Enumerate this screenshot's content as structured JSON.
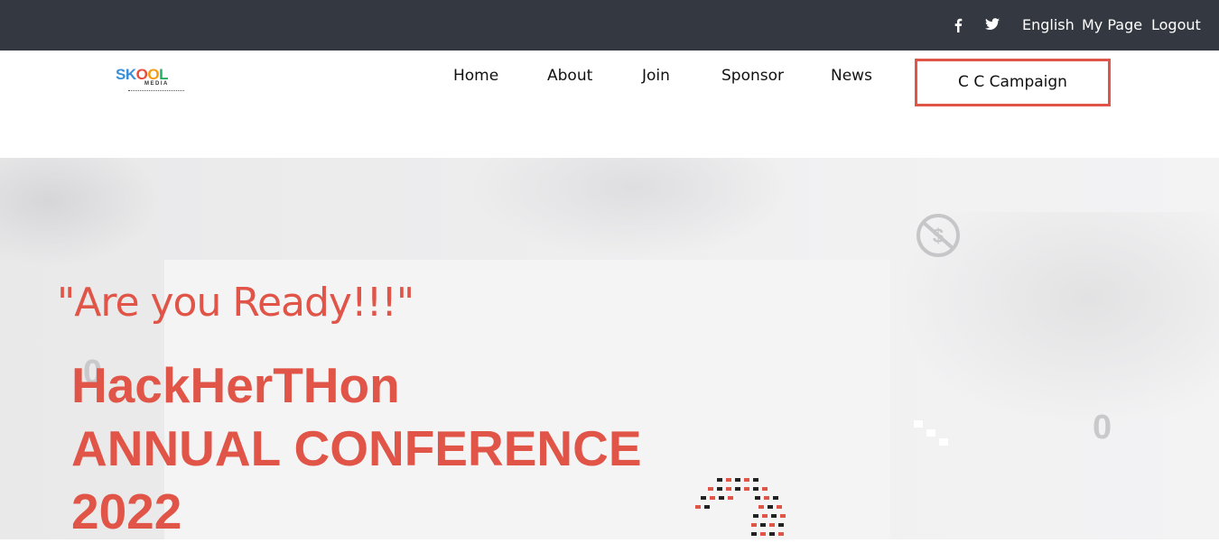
{
  "topbar": {
    "facebook_icon": "facebook-icon",
    "twitter_icon": "twitter-icon",
    "language": "English",
    "my_page": "My Page",
    "logout": "Logout"
  },
  "logo": {
    "text": "SKOOL",
    "sub": "MEDIA",
    "colors": [
      "#e74c3c",
      "#3498db",
      "#27ae60",
      "#f39c12"
    ]
  },
  "nav": {
    "items": [
      "Home",
      "About",
      "Join",
      "Sponsor",
      "News"
    ],
    "cta": "C C Campaign"
  },
  "hero": {
    "tagline": "\"Are you Ready!!!\"",
    "title_line1": "HackHerTHon",
    "title_line2": "ANNUAL CONFERENCE",
    "title_line3": "2022",
    "accent_color": "#e05548"
  },
  "decor": {
    "zero_1": "0",
    "zero_2": "0"
  }
}
